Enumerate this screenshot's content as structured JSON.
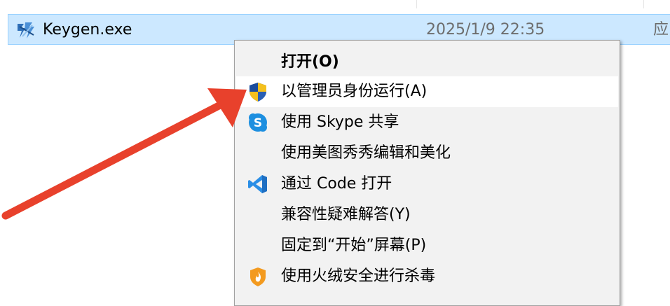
{
  "file": {
    "name": "Keygen.exe",
    "modified": "2025/1/9 22:35",
    "type_partial": "应",
    "icon": "keygen-app-icon"
  },
  "context_menu": {
    "items": [
      {
        "label": "打开(O)",
        "icon": "",
        "bold": true
      },
      {
        "label": "以管理员身份运行(A)",
        "icon": "uac-shield-icon",
        "highlighted": true
      },
      {
        "label": "使用 Skype 共享",
        "icon": "skype-icon"
      },
      {
        "label": "使用美图秀秀编辑和美化",
        "icon": ""
      },
      {
        "label": "通过 Code 打开",
        "icon": "vscode-icon"
      },
      {
        "label": "兼容性疑难解答(Y)",
        "icon": ""
      },
      {
        "label": "固定到“开始”屏幕(P)",
        "icon": ""
      },
      {
        "label": "使用火绒安全进行杀毒",
        "icon": "huorong-icon"
      }
    ]
  },
  "annotation": {
    "arrow_color": "#e8412c",
    "points_to": "以管理员身份运行(A)"
  },
  "colors": {
    "selection_bg": "#cce8ff",
    "selection_border": "#99d1ff",
    "menu_bg": "#f2f2f2",
    "menu_hover": "#ffffff"
  }
}
